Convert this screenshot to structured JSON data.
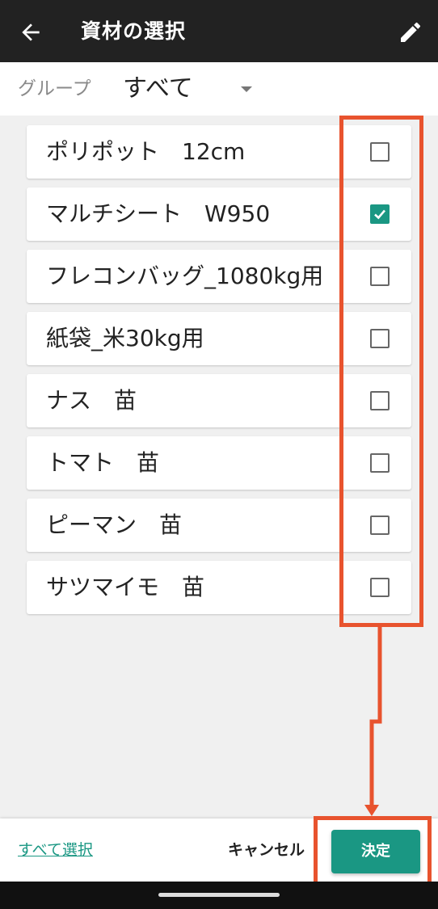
{
  "header": {
    "title": "資材の選択",
    "back_icon": "arrow-left-icon",
    "edit_icon": "pencil-icon",
    "background": "#222222"
  },
  "group": {
    "label": "グループ",
    "value": "すべて",
    "dropdown_icon": "triangle-down-icon"
  },
  "items": [
    {
      "name": "ポリポット　12cm",
      "checked": false
    },
    {
      "name": "マルチシート　W950",
      "checked": true
    },
    {
      "name": "フレコンバッグ_1080kg用",
      "checked": false
    },
    {
      "name": "紙袋_米30kg用",
      "checked": false
    },
    {
      "name": "ナス　苗",
      "checked": false
    },
    {
      "name": "トマト　苗",
      "checked": false
    },
    {
      "name": "ピーマン　苗",
      "checked": false
    },
    {
      "name": "サツマイモ　苗",
      "checked": false
    }
  ],
  "footer": {
    "select_all": "すべて選択",
    "cancel": "キャンセル",
    "confirm": "決定"
  },
  "colors": {
    "accent": "#1a9783",
    "highlight": "#e8532e"
  }
}
